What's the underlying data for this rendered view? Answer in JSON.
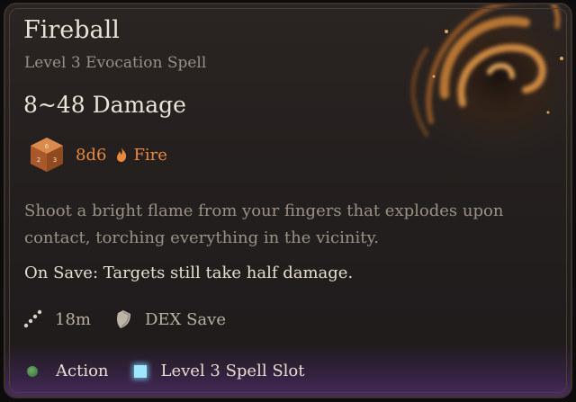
{
  "spell": {
    "name": "Fireball",
    "subtitle": "Level 3 Evocation Spell",
    "damage": "8~48 Damage",
    "dice": "8d6",
    "damage_type": "Fire",
    "description": "Shoot a bright flame from your fingers that explodes upon contact, torching everything in the vicinity.",
    "on_save": "On Save: Targets still take half damage."
  },
  "stats": {
    "range": "18m",
    "save": "DEX Save"
  },
  "costs": {
    "action": "Action",
    "spell_slot": "Level 3 Spell Slot"
  },
  "icons": {
    "art": "fireball-art-icon",
    "dice": "d6-dice-icon",
    "damage_type": "flame-icon",
    "range": "range-icon",
    "save": "save-shield-icon",
    "action": "action-dot-icon",
    "spell_slot": "spell-slot-icon"
  },
  "colors": {
    "title": "#eae2d5",
    "subtitle": "#9a8f84",
    "fire_accent": "#e8893f",
    "action_dot": "#4e8c4b",
    "spell_slot": "#9fe6ff"
  }
}
